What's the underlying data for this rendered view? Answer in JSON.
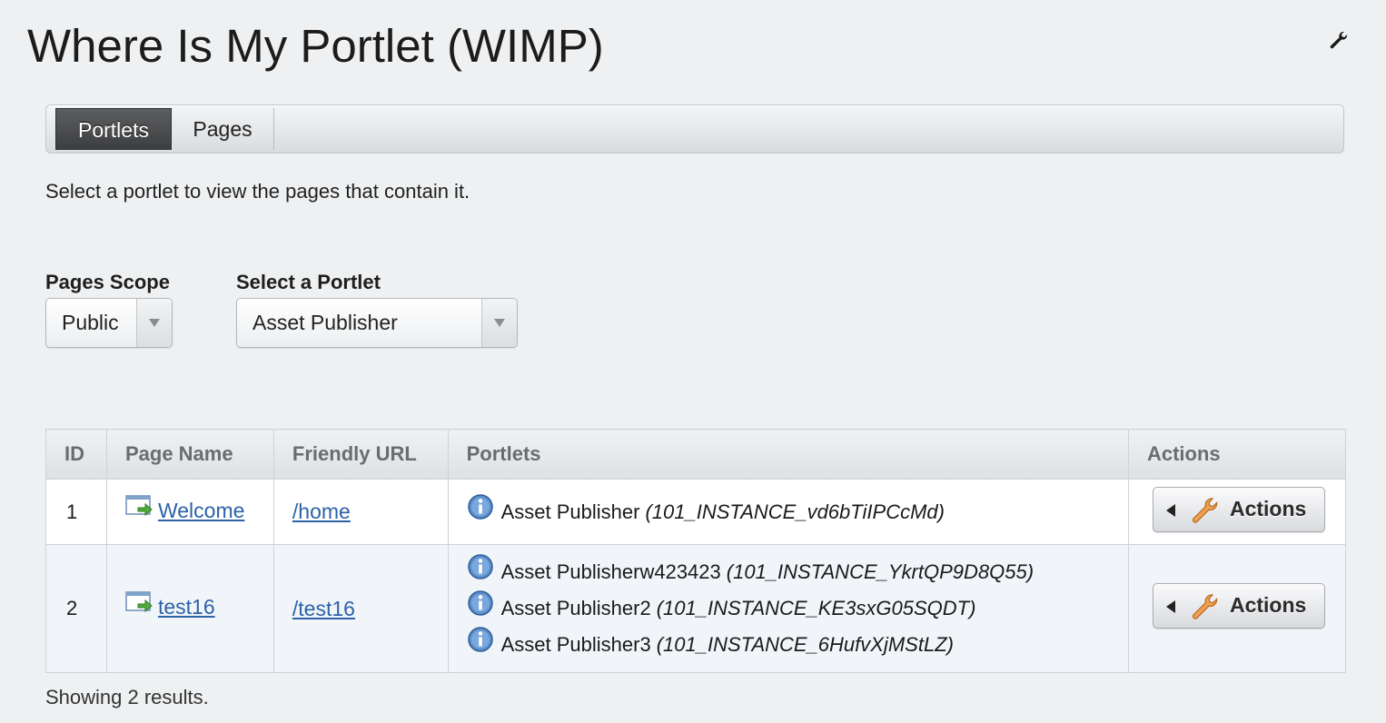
{
  "portlet_title": "Where Is My Portlet (WIMP)",
  "config_icon": "wrench-icon",
  "tabs": [
    {
      "label": "Portlets",
      "selected": true
    },
    {
      "label": "Pages",
      "selected": false
    }
  ],
  "intro_text": "Select a portlet to view the pages that contain it.",
  "filters": {
    "scope_label": "Pages Scope",
    "scope_value": "Public",
    "portlet_label": "Select a Portlet",
    "portlet_value": "Asset Publisher"
  },
  "table": {
    "headers": [
      "ID",
      "Page Name",
      "Friendly URL",
      "Portlets",
      "Actions"
    ],
    "rows": [
      {
        "id": "1",
        "page_name": "Welcome",
        "friendly_url": "/home",
        "portlets": [
          {
            "name": "Asset Publisher",
            "instance": "(101_INSTANCE_vd6bTiIPCcMd)"
          }
        ],
        "action_label": "Actions"
      },
      {
        "id": "2",
        "page_name": "test16",
        "friendly_url": "/test16",
        "portlets": [
          {
            "name": "Asset Publisherw423423",
            "instance": "(101_INSTANCE_YkrtQP9D8Q55)"
          },
          {
            "name": "Asset Publisher2",
            "instance": "(101_INSTANCE_KE3sxG05SQDT)"
          },
          {
            "name": "Asset Publisher3",
            "instance": "(101_INSTANCE_6HufvXjMStLZ)"
          }
        ],
        "action_label": "Actions"
      }
    ]
  },
  "results_text": "Showing 2 results.",
  "colors": {
    "link": "#2c62a8",
    "selected_tab": "#4a4b4d",
    "background": "#eef0f2"
  }
}
